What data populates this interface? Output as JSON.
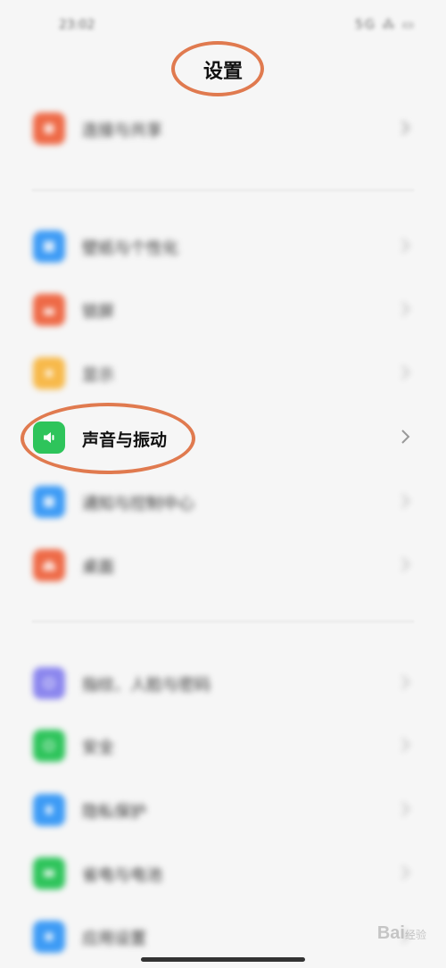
{
  "status_bar": {
    "time": "23:02",
    "icons": "5G ⁂ ▭"
  },
  "header": {
    "title": "设置"
  },
  "settings_items": [
    {
      "label": "连接与共享",
      "icon": "share-icon",
      "color": "#ee6a47"
    },
    {
      "label": "壁纸与个性化",
      "icon": "wallpaper-icon",
      "color": "#3d9bf5"
    },
    {
      "label": "锁屏",
      "icon": "lock-icon",
      "color": "#ee6a47"
    },
    {
      "label": "显示",
      "icon": "display-icon",
      "color": "#f7b94a"
    },
    {
      "label": "声音与振动",
      "icon": "speaker-icon",
      "color": "#2ec45b"
    },
    {
      "label": "通知与控制中心",
      "icon": "notification-icon",
      "color": "#3d9bf5"
    },
    {
      "label": "桌面",
      "icon": "home-icon",
      "color": "#ee6a47"
    },
    {
      "label": "指纹、人脸与密码",
      "icon": "fingerprint-icon",
      "color": "#8b86ee"
    },
    {
      "label": "安全",
      "icon": "security-icon",
      "color": "#2ec45b"
    },
    {
      "label": "隐私保护",
      "icon": "privacy-icon",
      "color": "#3d9bf5"
    },
    {
      "label": "省电与电池",
      "icon": "battery-icon",
      "color": "#2ec45b"
    },
    {
      "label": "应用设置",
      "icon": "apps-icon",
      "color": "#3d9bf5"
    }
  ],
  "watermark": {
    "text": "Bai",
    "sub": "经验"
  },
  "annotation_color": "#e07a4f"
}
